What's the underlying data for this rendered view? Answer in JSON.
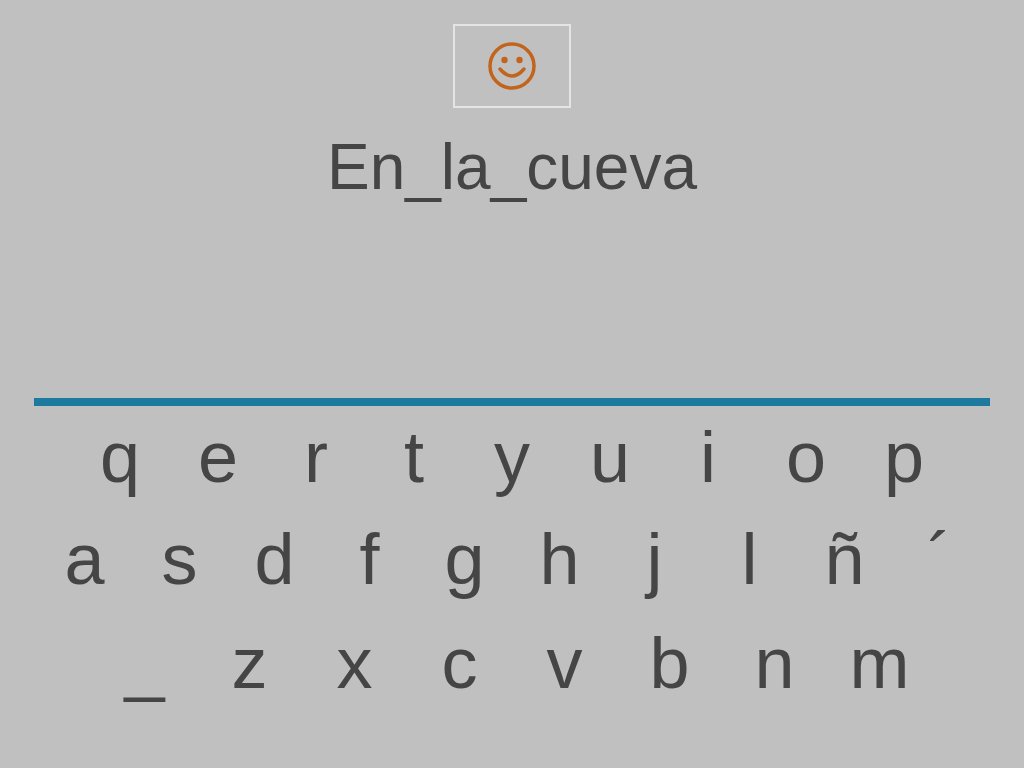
{
  "title": "En_la_cueva",
  "keyboard": [
    [
      "q",
      "e",
      "r",
      "t",
      "y",
      "u",
      "i",
      "o",
      "p"
    ],
    [
      "a",
      "s",
      "d",
      "f",
      "g",
      "h",
      "j",
      "l",
      "ñ",
      "´"
    ],
    [
      "_",
      "z",
      "x",
      "c",
      "v",
      "b",
      "n",
      "m"
    ]
  ]
}
